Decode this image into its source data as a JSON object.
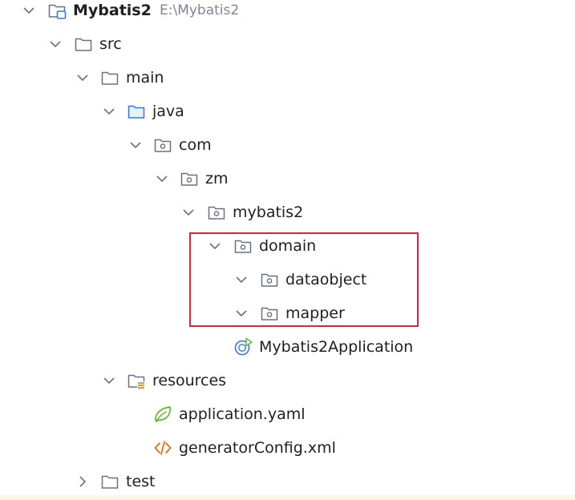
{
  "tree": {
    "project": {
      "name": "Mybatis2",
      "path": "E:\\Mybatis2"
    },
    "src": "src",
    "main": "main",
    "java": "java",
    "com": "com",
    "zm": "zm",
    "mybatis2": "mybatis2",
    "domain": "domain",
    "dataobject": "dataobject",
    "mapper": "mapper",
    "app_class": "Mybatis2Application",
    "resources": "resources",
    "application_yaml": "application.yaml",
    "generator_config": "generatorConfig.xml",
    "test": "test"
  },
  "colors": {
    "highlight_border": "#d9263b",
    "folder_icon": "#6c707e",
    "source_folder_icon": "#3574f0",
    "spring_icon": "#5fb832",
    "xml_icon": "#e66d17",
    "path_text": "#818594"
  }
}
